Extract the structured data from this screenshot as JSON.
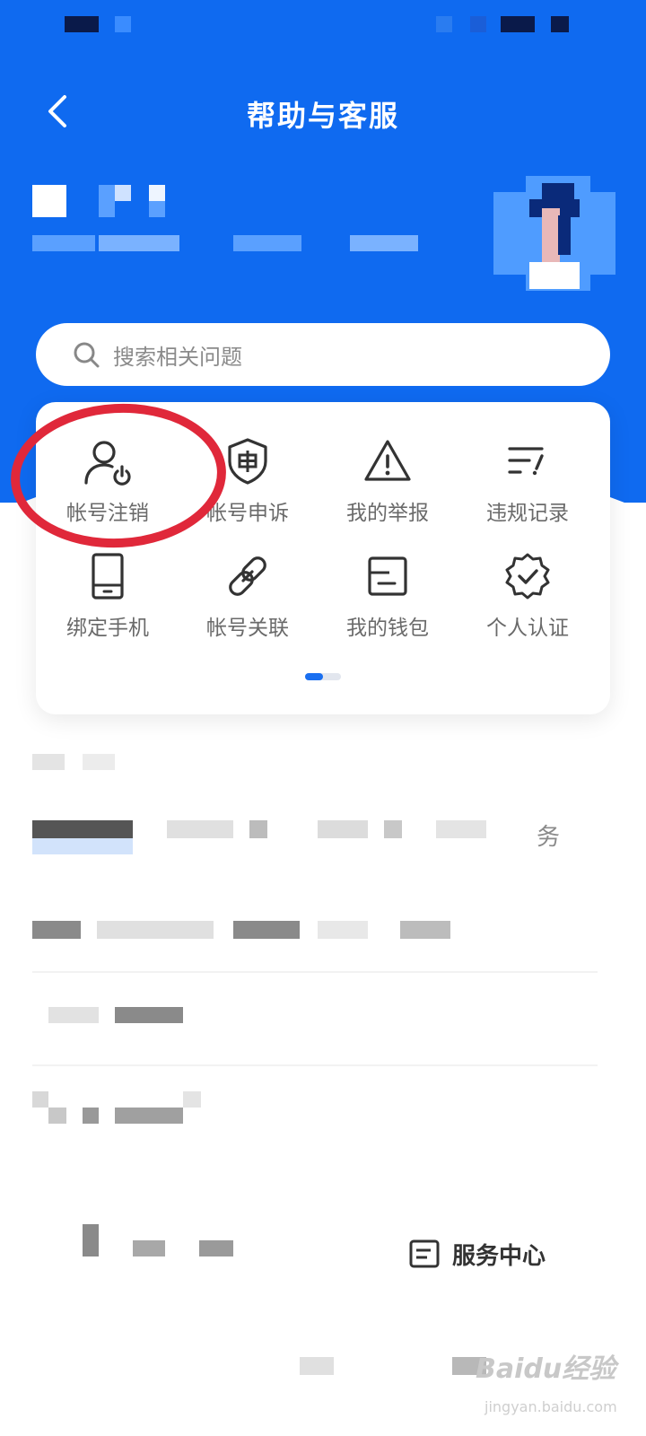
{
  "header": {
    "title": "帮助与客服"
  },
  "search": {
    "placeholder": "搜索相关问题"
  },
  "quick_actions": [
    {
      "label": "帐号注销",
      "icon": "user-power-icon"
    },
    {
      "label": "帐号申诉",
      "icon": "shield-appeal-icon"
    },
    {
      "label": "我的举报",
      "icon": "warning-icon"
    },
    {
      "label": "违规记录",
      "icon": "violation-list-icon"
    },
    {
      "label": "绑定手机",
      "icon": "phone-icon"
    },
    {
      "label": "帐号关联",
      "icon": "link-icon"
    },
    {
      "label": "我的钱包",
      "icon": "wallet-icon"
    },
    {
      "label": "个人认证",
      "icon": "verified-badge-icon"
    }
  ],
  "pager": {
    "current": 1,
    "total": 2
  },
  "list": {
    "trailing_char": "务"
  },
  "bottom": {
    "service_label": "服务中心"
  },
  "watermark": {
    "text": "Baidu经验",
    "sub": "jingyan.baidu.com"
  },
  "colors": {
    "primary": "#0f6af0",
    "highlight": "#e0283a",
    "icon": "#333333",
    "label": "#6a6a6a"
  }
}
